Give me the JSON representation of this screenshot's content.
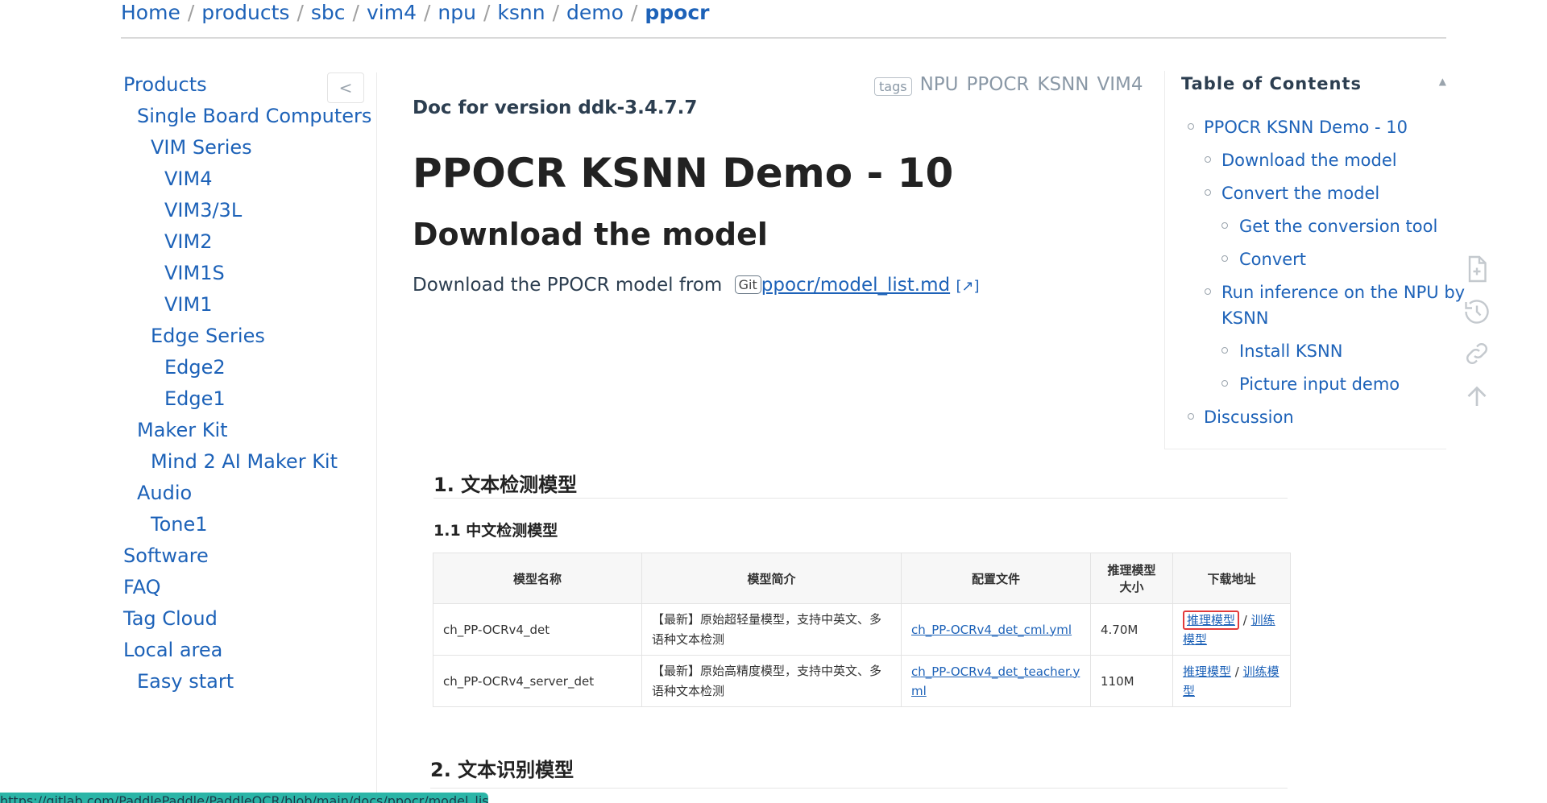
{
  "breadcrumb": {
    "items": [
      "Home",
      "products",
      "sbc",
      "vim4",
      "npu",
      "ksnn",
      "demo"
    ],
    "current": "ppocr"
  },
  "sidebar": {
    "collapse_label": "<",
    "items": [
      {
        "label": "Products"
      },
      {
        "label": "Single Board Computers"
      },
      {
        "label": "VIM Series"
      },
      {
        "label": "VIM4"
      },
      {
        "label": "VIM3/3L"
      },
      {
        "label": "VIM2"
      },
      {
        "label": "VIM1S"
      },
      {
        "label": "VIM1"
      },
      {
        "label": "Edge Series"
      },
      {
        "label": "Edge2"
      },
      {
        "label": "Edge1"
      },
      {
        "label": "Maker Kit"
      },
      {
        "label": "Mind 2 AI Maker Kit"
      },
      {
        "label": "Audio"
      },
      {
        "label": "Tone1"
      },
      {
        "label": "Software"
      },
      {
        "label": "FAQ"
      },
      {
        "label": "Tag Cloud"
      },
      {
        "label": "Local area"
      },
      {
        "label": "Easy start"
      }
    ]
  },
  "tags": {
    "badge": "tags",
    "items": [
      "NPU",
      "PPOCR",
      "KSNN",
      "VIM4"
    ]
  },
  "main": {
    "doc_version": "Doc for version ddk-3.4.7.7",
    "title": "PPOCR KSNN Demo - 10",
    "section_title": "Download the model",
    "download_text": "Download the PPOCR model from",
    "git_badge": "Git",
    "model_link": "ppocr/model_list.md",
    "ext_icon": "[↗]"
  },
  "embedded": {
    "h1_detection": "1. 文本检测模型",
    "h2_chinese": "1.1 中文检测模型",
    "table": {
      "headers": [
        "模型名称",
        "模型简介",
        "配置文件",
        "推理模型大小",
        "下载地址"
      ],
      "rows": [
        {
          "name": "ch_PP-OCRv4_det",
          "desc": "【最新】原始超轻量模型，支持中英文、多语种文本检测",
          "config": "ch_PP-OCRv4_det_cml.yml",
          "size": "4.70M",
          "dl_infer": "推理模型",
          "dl_sep": " / ",
          "dl_train": "训练模型"
        },
        {
          "name": "ch_PP-OCRv4_server_det",
          "desc": "【最新】原始高精度模型，支持中英文、多语种文本检测",
          "config": "ch_PP-OCRv4_det_teacher.yml",
          "size": "110M",
          "dl_infer": "推理模型",
          "dl_sep": " / ",
          "dl_train": "训练模型"
        }
      ]
    },
    "h1_recognition": "2. 文本识别模型"
  },
  "toc": {
    "title": "Table of Contents",
    "collapse": "▲",
    "items": [
      {
        "label": "PPOCR KSNN Demo - 10"
      },
      {
        "label": "Download the model"
      },
      {
        "label": "Convert the model"
      },
      {
        "label": "Get the conversion tool"
      },
      {
        "label": "Convert"
      },
      {
        "label": "Run inference on the NPU by"
      },
      {
        "label": "KSNN"
      },
      {
        "label": "Install KSNN"
      },
      {
        "label": "Picture input demo"
      },
      {
        "label": "Discussion"
      }
    ]
  },
  "float_icons": [
    "edit-file-icon",
    "history-icon",
    "link-icon",
    "back-to-top-icon"
  ],
  "status_url": "https://gitlab.com/PaddlePaddle/PaddleOCR/blob/main/docs/ppocr/model_list.md",
  "colors": {
    "link": "#1d62b8",
    "text": "#2c3e50",
    "status_bar": "#2bb5a7",
    "highlight": "#e23b3b"
  }
}
